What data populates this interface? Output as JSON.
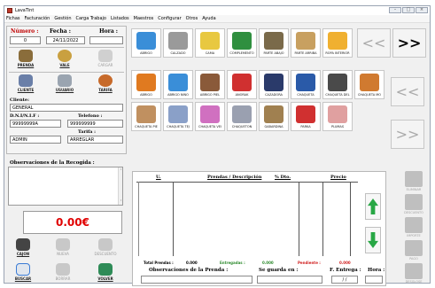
{
  "window": {
    "title": "LavaTint"
  },
  "menu": [
    "Fichas",
    "Facturación",
    "Gestión",
    "Carga Trabajo",
    "Listados",
    "Maestros",
    "Configurar",
    "Otros",
    "Ayuda"
  ],
  "ticket": {
    "numero_label": "Número :",
    "numero_value": "0",
    "fecha_label": "Fecha :",
    "fecha_value": "24/11/2022",
    "hora_label": "Hora :",
    "hora_value": ""
  },
  "actions_top": [
    {
      "label": "PRENDA",
      "icon": "garment-icon",
      "color": "#8a6d3b"
    },
    {
      "label": "VALE",
      "icon": "voucher-icon",
      "color": "#c9a040"
    },
    {
      "label": "CARGAR",
      "icon": "load-icon",
      "color": "#c8c8c8"
    }
  ],
  "actions_mid": [
    {
      "label": "CLIENTE",
      "icon": "client-icon",
      "color": "#6a7fa8"
    },
    {
      "label": "USUARIO",
      "icon": "user-icon",
      "color": "#9aa4b0"
    },
    {
      "label": "TARIFA",
      "icon": "rate-icon",
      "color": "#c76a2a"
    }
  ],
  "cliente": {
    "label": "Cliente:",
    "value": "GENERAL",
    "dni_label": "D.N.I/N.I.F :",
    "dni_value": "99999999A",
    "tel_label": "Telefono :",
    "tel_value": "999999999",
    "tarifa_label": "Tarifa :",
    "user_value": "ADMIN",
    "tarifa_value": "ARREGLAR"
  },
  "observaciones_recogida": "Observaciones de la Recogida :",
  "total": "0.00€",
  "bottom_buttons": [
    {
      "label": "CAJON",
      "enabled": true,
      "color": "#444444"
    },
    {
      "label": "NUEVA",
      "enabled": false,
      "color": "#c8c8c8"
    },
    {
      "label": "DESCUENTO",
      "enabled": false,
      "color": "#c8c8c8"
    },
    {
      "label": "BUSCAR",
      "enabled": true,
      "color": "#3a7bd5"
    },
    {
      "label": "BORRAR",
      "enabled": false,
      "color": "#c8c8c8"
    },
    {
      "label": "VOLVER",
      "enabled": true,
      "color": "#2e8b57"
    }
  ],
  "categories_row1": [
    {
      "label": "ABRIGO",
      "color": "#3a8ed8"
    },
    {
      "label": "CALZADO",
      "color": "#9a9a9a"
    },
    {
      "label": "CAMA",
      "color": "#e8c840"
    },
    {
      "label": "COMPLEMENTO",
      "color": "#2f8f3f"
    },
    {
      "label": "PARTE ABAJO",
      "color": "#7a6a4a"
    },
    {
      "label": "PARTE ARRIBA",
      "color": "#c8a060"
    },
    {
      "label": "ROPA INTERIOR",
      "color": "#f0b030"
    }
  ],
  "categories_row2": [
    {
      "label": "ABRIGO",
      "color": "#e07a20"
    },
    {
      "label": "ABRIGO NIÑO",
      "color": "#3a8ed8"
    },
    {
      "label": "ABRIGO PIEL",
      "color": "#8a5a3a"
    },
    {
      "label": "ANORAK",
      "color": "#d03030"
    },
    {
      "label": "CAZADORA",
      "color": "#2a3a6a"
    },
    {
      "label": "CHAQUETA",
      "color": "#2a5aa8"
    },
    {
      "label": "CHAQUETA DEL",
      "color": "#4a4a4a"
    },
    {
      "label": "CHAQUETA MO",
      "color": "#d07a30"
    }
  ],
  "categories_row3": [
    {
      "label": "CHAQUETA PIE",
      "color": "#c09060"
    },
    {
      "label": "CHAQUETA TEJ",
      "color": "#8aa0c8"
    },
    {
      "label": "CHAQUETA VEI",
      "color": "#d070c0"
    },
    {
      "label": "CHAQUETON",
      "color": "#9aa0b0"
    },
    {
      "label": "GABARDINA",
      "color": "#a08050"
    },
    {
      "label": "PARKA",
      "color": "#d03030"
    },
    {
      "label": "PLUMAS",
      "color": "#e0a0a0"
    }
  ],
  "nav": {
    "prev": "<<",
    "next": ">>"
  },
  "lines_table": {
    "headers": {
      "u": "U.",
      "desc": "Prendas / Descripción",
      "dto": "% Dto.",
      "precio": "Precio"
    },
    "total_prendas_label": "Total Prendas :",
    "total_prendas": "0.000",
    "entregadas_label": "Entregadas :",
    "entregadas": "0.000",
    "pendiente_label": "Pendiente :",
    "pendiente": "0.000",
    "obs_prenda_label": "Observaciones de la Prenda :",
    "guarda_label": "Se guarda en :",
    "entrega_label": "F. Entrega :",
    "entrega_value": "/ /",
    "hora_label": "Hora :"
  },
  "side_buttons": [
    "ELIMINAR",
    "DESCUENTO",
    "IMPORTE",
    "PAGO",
    "DESGLOSE"
  ]
}
